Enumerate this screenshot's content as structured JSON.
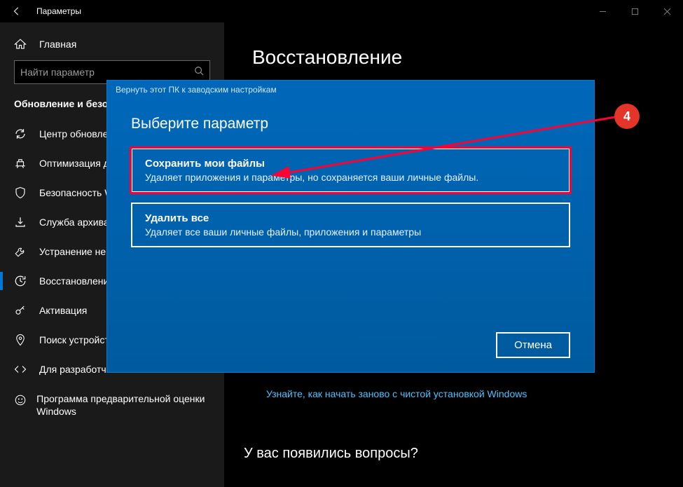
{
  "window": {
    "title": "Параметры"
  },
  "sidebar": {
    "home": "Главная",
    "search_placeholder": "Найти параметр",
    "category": "Обновление и безопасность",
    "items": [
      {
        "label": "Центр обновления Windows"
      },
      {
        "label": "Оптимизация доставки"
      },
      {
        "label": "Безопасность Windows"
      },
      {
        "label": "Служба архивации"
      },
      {
        "label": "Устранение неполадок"
      },
      {
        "label": "Восстановление"
      },
      {
        "label": "Активация"
      },
      {
        "label": "Поиск устройства"
      },
      {
        "label": "Для разработчиков"
      },
      {
        "label": "Программа предварительной оценки Windows"
      }
    ]
  },
  "content": {
    "title": "Восстановление",
    "help_link": "Узнайте, как начать заново с чистой установкой Windows",
    "question": "У вас появились вопросы?"
  },
  "modal": {
    "header": "Вернуть этот ПК к заводским настройкам",
    "title": "Выберите параметр",
    "option1": {
      "title": "Сохранить мои файлы",
      "desc": "Удаляет приложения и параметры, но сохраняется ваши личные файлы."
    },
    "option2": {
      "title": "Удалить все",
      "desc": "Удаляет все ваши личные файлы, приложения и параметры"
    },
    "cancel": "Отмена"
  },
  "annotation": {
    "badge": "4"
  }
}
